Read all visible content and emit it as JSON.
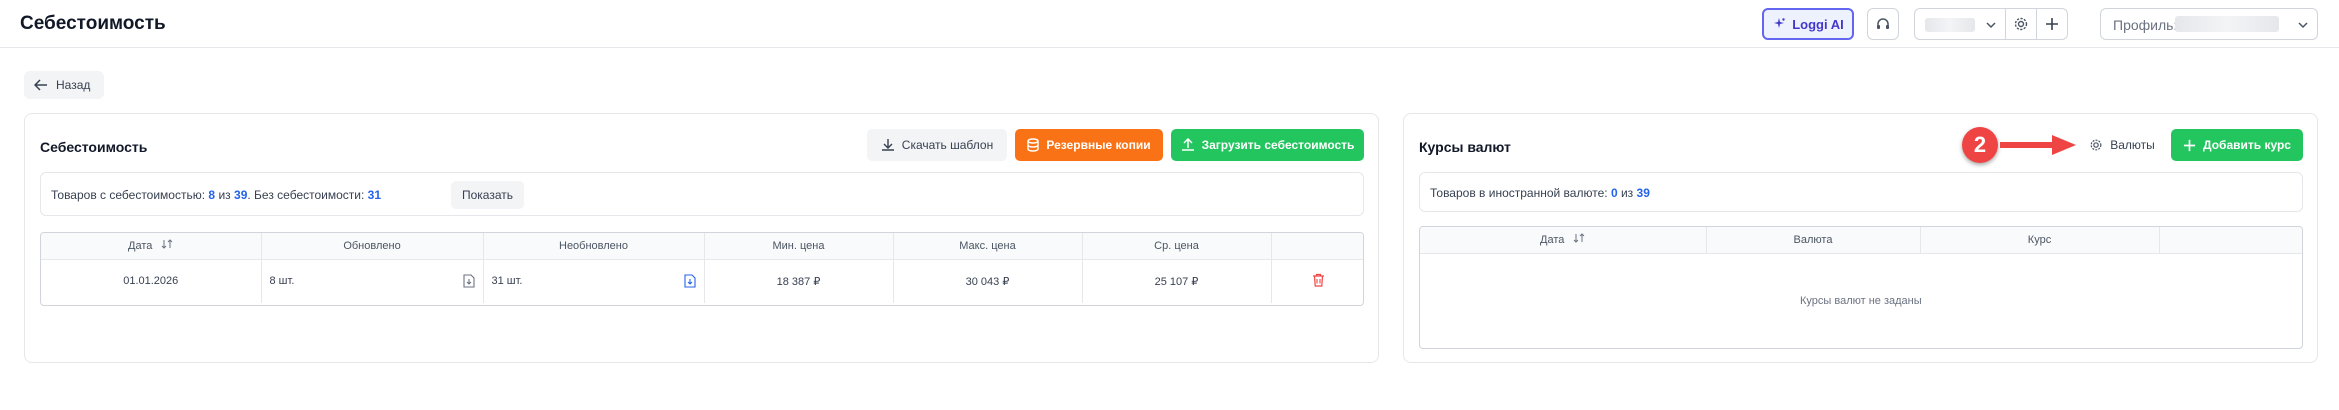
{
  "header": {
    "title": "Себестоимость",
    "ai_button": "Loggi AI",
    "profile_label": "Профиль:"
  },
  "back": {
    "label": "Назад"
  },
  "cost_card": {
    "title": "Себестоимость",
    "download_template": "Скачать шаблон",
    "backups": "Резервные копии",
    "upload": "Загрузить себестоимость",
    "stats": {
      "prefix": "Товаров с себестоимостью:",
      "with_cost": "8",
      "of_word": "из",
      "total": "39",
      "without_label": ". Без себестоимости:",
      "without_cost": "31",
      "show_button": "Показать"
    },
    "table": {
      "headers": [
        "Дата",
        "Обновлено",
        "Необновлено",
        "Мин. цена",
        "Макс. цена",
        "Ср. цена",
        ""
      ],
      "rows": [
        {
          "date": "01.01.2026",
          "updated": "8 шт.",
          "not_updated": "31 шт.",
          "min_price": "18 387 ₽",
          "max_price": "30 043 ₽",
          "avg_price": "25 107 ₽"
        }
      ]
    }
  },
  "currency_card": {
    "title": "Курсы валют",
    "currencies_button": "Валюты",
    "add_rate": "Добавить курс",
    "stats": {
      "prefix": "Товаров в иностранной валюте:",
      "count": "0",
      "of_word": "из",
      "total": "39"
    },
    "table": {
      "headers": [
        "Дата",
        "Валюта",
        "Курс",
        ""
      ],
      "empty": "Курсы валют не заданы"
    }
  },
  "annotation": {
    "number": "2",
    "color": "#ef4444"
  },
  "colors": {
    "accent_blue": "#2563eb",
    "orange": "#f97316",
    "green": "#22c55e",
    "danger": "#ef4444",
    "ai_border": "#6366f1"
  }
}
